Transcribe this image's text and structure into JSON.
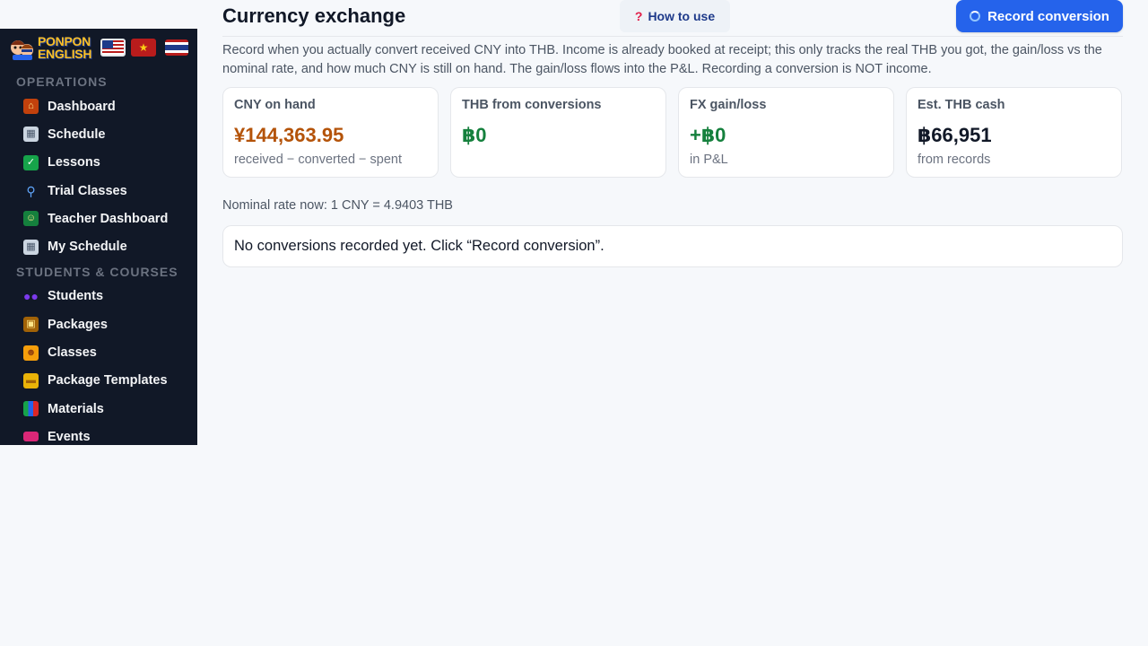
{
  "app": {
    "logo_line1": "PONPON",
    "logo_line2": "ENGLISH"
  },
  "sidebar": {
    "sections": [
      {
        "title": "OPERATIONS",
        "items": [
          {
            "label": "Dashboard",
            "icon": "house-icon"
          },
          {
            "label": "Schedule",
            "icon": "calendar-icon"
          },
          {
            "label": "Lessons",
            "icon": "checkmark-icon"
          },
          {
            "label": "Trial Classes",
            "icon": "magnifier-icon"
          },
          {
            "label": "Teacher Dashboard",
            "icon": "teacher-icon"
          },
          {
            "label": "My Schedule",
            "icon": "calendar-icon"
          }
        ]
      },
      {
        "title": "STUDENTS & COURSES",
        "items": [
          {
            "label": "Students",
            "icon": "people-icon"
          },
          {
            "label": "Packages",
            "icon": "package-icon"
          },
          {
            "label": "Classes",
            "icon": "group-icon"
          },
          {
            "label": "Package Templates",
            "icon": "folder-icon"
          },
          {
            "label": "Materials",
            "icon": "books-icon"
          },
          {
            "label": "Events",
            "icon": "ticket-icon"
          }
        ]
      }
    ]
  },
  "header": {
    "title": "Currency exchange",
    "how_to_use": "How to use",
    "record_button": "Record conversion"
  },
  "description": "Record when you actually convert received CNY into THB. Income is already booked at receipt; this only tracks the real THB you got, the gain/loss vs the nominal rate, and how much CNY is still on hand. The gain/loss flows into the P&L. Recording a conversion is NOT income.",
  "cards": [
    {
      "label": "CNY on hand",
      "value": "¥144,363.95",
      "sub": "received − converted − spent",
      "color": "#b45309"
    },
    {
      "label": "THB from conversions",
      "value": "฿0",
      "sub": "",
      "color": "#15803d"
    },
    {
      "label": "FX gain/loss",
      "value": "+฿0",
      "sub": "in P&L",
      "color": "#15803d"
    },
    {
      "label": "Est. THB cash",
      "value": "฿66,951",
      "sub": "from records",
      "color": "#111827"
    }
  ],
  "rate_note": "Nominal rate now: 1 CNY = 4.9403 THB",
  "empty_message": "No conversions recorded yet. Click “Record conversion”."
}
